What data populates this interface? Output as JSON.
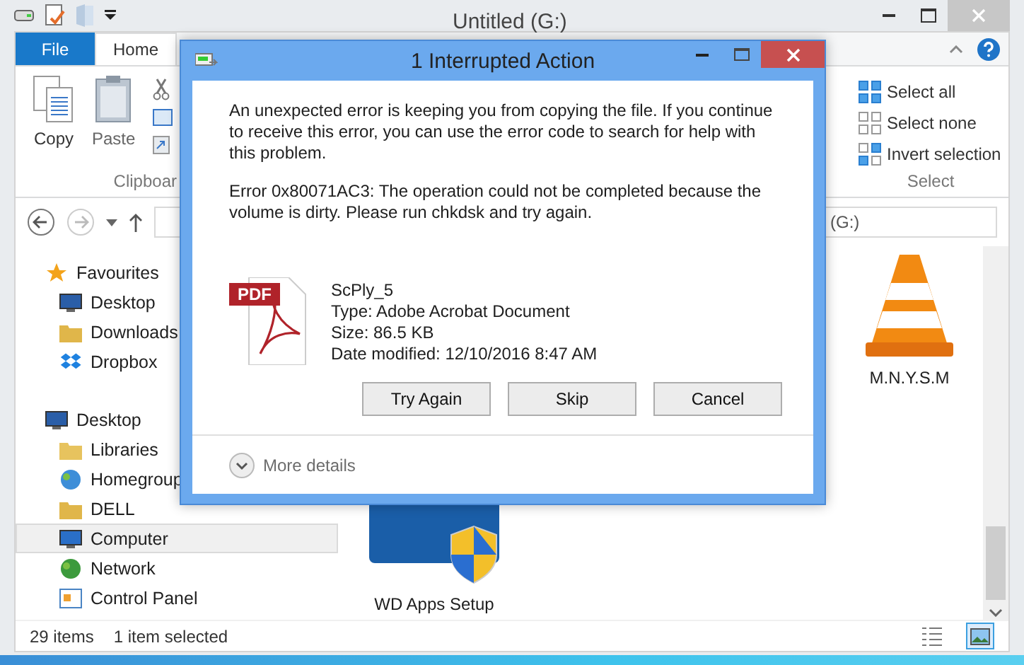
{
  "window": {
    "title": "Untitled (G:)"
  },
  "ribbon": {
    "tabs": [
      {
        "label": "File",
        "kind": "file",
        "selected": false
      },
      {
        "label": "Home",
        "kind": "tab",
        "selected": true
      }
    ],
    "clipboard": {
      "buttons": [
        "Copy",
        "Paste"
      ],
      "group_label": "Clipboar"
    },
    "select": {
      "items": [
        "Select all",
        "Select none",
        "Invert selection"
      ],
      "group_label": "Select"
    }
  },
  "search": {
    "placeholder": "(G:)"
  },
  "nav_pane": {
    "items": [
      {
        "label": "Favourites",
        "selected": false,
        "children": [
          {
            "label": "Desktop",
            "selected": false
          },
          {
            "label": "Downloads",
            "selected": false
          },
          {
            "label": "Dropbox",
            "selected": false
          }
        ]
      },
      {
        "label": "Desktop",
        "selected": false,
        "children": [
          {
            "label": "Libraries",
            "selected": false
          },
          {
            "label": "Homegroup",
            "selected": false
          },
          {
            "label": "DELL",
            "selected": false
          },
          {
            "label": "Computer",
            "selected": true
          },
          {
            "label": "Network",
            "selected": false
          },
          {
            "label": "Control Panel",
            "selected": false
          }
        ]
      }
    ]
  },
  "files": [
    {
      "name": "M.N.Y.S.M"
    },
    {
      "name": "WD Apps Setup"
    }
  ],
  "status_bar": {
    "item_count": "29 items",
    "selection": "1 item selected"
  },
  "view_buttons": [
    {
      "selected": false
    },
    {
      "selected": true
    }
  ],
  "dialog": {
    "title": "1 Interrupted Action",
    "message": "An unexpected error is keeping you from copying the file. If you continue to receive this error, you can use the error code to search for help with this problem.",
    "error": "Error 0x80071AC3: The operation could not be completed because the volume is dirty. Please run chkdsk and try again.",
    "file": {
      "badge": "PDF",
      "name": "ScPly_5",
      "type": "Type: Adobe Acrobat Document",
      "size": "Size: 86.5 KB",
      "modified": "Date modified: 12/10/2016 8:47 AM"
    },
    "buttons": [
      "Try Again",
      "Skip",
      "Cancel"
    ],
    "more_details": "More details"
  }
}
